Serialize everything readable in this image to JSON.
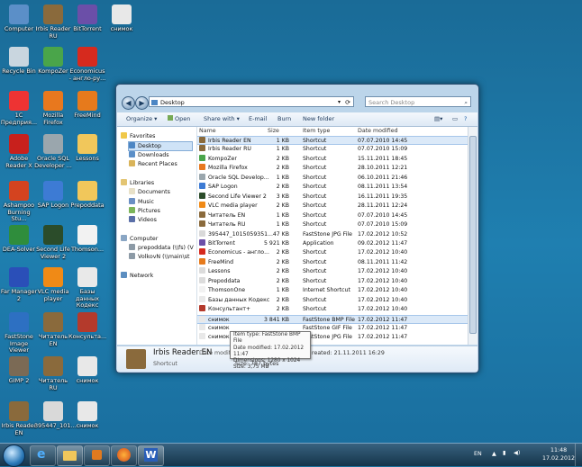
{
  "desktop_icons": [
    {
      "label": "Computer",
      "icon": "computer-icon",
      "color": "#5b8fc8"
    },
    {
      "label": "Irbis Reader RU",
      "icon": "irbis-icon",
      "color": "#8a6a3c"
    },
    {
      "label": "BitTorrent",
      "icon": "bittorrent-icon",
      "color": "#6b4fa8"
    },
    {
      "label": "снимок",
      "icon": "image-file-icon",
      "color": "#e8e8e8"
    },
    {
      "label": "Recycle Bin",
      "icon": "recycle-bin-icon",
      "color": "#c9d6df"
    },
    {
      "label": "KompoZer",
      "icon": "kompozer-icon",
      "color": "#4aa54a"
    },
    {
      "label": "Economicus - англо-ру...",
      "icon": "economicus-icon",
      "color": "#d62a1e"
    },
    {
      "label": "1С Предприя...",
      "icon": "1c-icon",
      "color": "#e33"
    },
    {
      "label": "Mozilla Firefox",
      "icon": "firefox-icon",
      "color": "#e8781e"
    },
    {
      "label": "FreeMind",
      "icon": "freemind-icon",
      "color": "#e67a1c"
    },
    {
      "label": "Adobe Reader X",
      "icon": "adobe-reader-icon",
      "color": "#c8201c"
    },
    {
      "label": "Oracle SQL Developer ...",
      "icon": "oracle-sql-icon",
      "color": "#9aa6ad"
    },
    {
      "label": "Lessons",
      "icon": "folder-icon",
      "color": "#f1c75b"
    },
    {
      "label": "Ashampoo Burning Stu...",
      "icon": "ashampoo-icon",
      "color": "#d4431f"
    },
    {
      "label": "SAP Logon",
      "icon": "sap-icon",
      "color": "#3d7bd4"
    },
    {
      "label": "Prepoddata",
      "icon": "folder-icon",
      "color": "#f1c75b"
    },
    {
      "label": "DEA-Solver",
      "icon": "dea-solver-icon",
      "color": "#2f8d3c"
    },
    {
      "label": "Second Life Viewer 2",
      "icon": "second-life-icon",
      "color": "#2b4c2a"
    },
    {
      "label": "Thomson...",
      "icon": "document-icon",
      "color": "#f2f2f2"
    },
    {
      "label": "Far Manager 2",
      "icon": "far-manager-icon",
      "color": "#2a4fb8"
    },
    {
      "label": "VLC media player",
      "icon": "vlc-icon",
      "color": "#f08a16"
    },
    {
      "label": "Базы данных Кодекс",
      "icon": "kodeks-icon",
      "color": "#e9e9e9"
    },
    {
      "label": "FastStone Image Viewer",
      "icon": "faststone-icon",
      "color": "#2d70c2"
    },
    {
      "label": "Читатель EN",
      "icon": "irbis-icon",
      "color": "#8a6a3c"
    },
    {
      "label": "Консульта...",
      "icon": "consultant-icon",
      "color": "#b43a2c"
    },
    {
      "label": "GIMP 2",
      "icon": "gimp-icon",
      "color": "#7b6a55"
    },
    {
      "label": "Читатель RU",
      "icon": "irbis-icon",
      "color": "#8a6a3c"
    },
    {
      "label": "снимок",
      "icon": "image-file-icon",
      "color": "#e8e8e8"
    },
    {
      "label": "Irbis Reader EN",
      "icon": "irbis-icon",
      "color": "#8a6a3c"
    },
    {
      "label": "395447_101...",
      "icon": "image-file-icon",
      "color": "#d9d9d9"
    },
    {
      "label": "снимок",
      "icon": "image-file-icon",
      "color": "#e8e8e8"
    }
  ],
  "window": {
    "address": "Desktop",
    "search_placeholder": "Search Desktop",
    "toolbar": {
      "organize": "Organize ▾",
      "open": "Open",
      "share": "Share with ▾",
      "email": "E-mail",
      "burn": "Burn",
      "new_folder": "New folder"
    },
    "nav": {
      "favorites": "Favorites",
      "desktop": "Desktop",
      "downloads": "Downloads",
      "recent": "Recent Places",
      "libraries": "Libraries",
      "documents": "Documents",
      "music": "Music",
      "pictures": "Pictures",
      "videos": "Videos",
      "computer": "Computer",
      "drive1": "prepoddata (\\\\fs) (V",
      "drive2": "VolkovN (\\\\main\\st",
      "network": "Network"
    },
    "columns": {
      "name": "Name",
      "size": "Size",
      "type": "Item type",
      "date": "Date modified"
    },
    "files": [
      {
        "name": "Irbis Reader EN",
        "size": "1 KB",
        "type": "Shortcut",
        "date": "07.07.2010 14:45",
        "icon": "irbis-icon",
        "color": "#8a6a3c"
      },
      {
        "name": "Irbis Reader RU",
        "size": "1 KB",
        "type": "Shortcut",
        "date": "07.07.2010 15:09",
        "icon": "irbis-icon",
        "color": "#8a6a3c"
      },
      {
        "name": "KompoZer",
        "size": "2 KB",
        "type": "Shortcut",
        "date": "15.11.2011 18:45",
        "icon": "kompozer-icon",
        "color": "#4aa54a"
      },
      {
        "name": "Mozilla Firefox",
        "size": "2 KB",
        "type": "Shortcut",
        "date": "28.10.2011 12:21",
        "icon": "firefox-icon",
        "color": "#e8781e"
      },
      {
        "name": "Oracle SQL Develop...",
        "size": "1 KB",
        "type": "Shortcut",
        "date": "06.10.2011 21:46",
        "icon": "oracle-sql-icon",
        "color": "#9aa6ad"
      },
      {
        "name": "SAP Logon",
        "size": "2 KB",
        "type": "Shortcut",
        "date": "08.11.2011 13:54",
        "icon": "sap-icon",
        "color": "#3d7bd4"
      },
      {
        "name": "Second Life Viewer 2",
        "size": "3 KB",
        "type": "Shortcut",
        "date": "16.11.2011 19:35",
        "icon": "second-life-icon",
        "color": "#2b4c2a"
      },
      {
        "name": "VLC media player",
        "size": "2 KB",
        "type": "Shortcut",
        "date": "28.11.2011 12:24",
        "icon": "vlc-icon",
        "color": "#f08a16"
      },
      {
        "name": "Читатель EN",
        "size": "1 KB",
        "type": "Shortcut",
        "date": "07.07.2010 14:45",
        "icon": "irbis-icon",
        "color": "#8a6a3c"
      },
      {
        "name": "Читатель RU",
        "size": "1 KB",
        "type": "Shortcut",
        "date": "07.07.2010 15:09",
        "icon": "irbis-icon",
        "color": "#8a6a3c"
      },
      {
        "name": "395447_1015059351...",
        "size": "47 KB",
        "type": "FastStone JPG File",
        "date": "17.02.2012 10:52",
        "icon": "image-file-icon",
        "color": "#d9d9d9"
      },
      {
        "name": "BitTorrent",
        "size": "5 921 KB",
        "type": "Application",
        "date": "09.02.2012 11:47",
        "icon": "bittorrent-icon",
        "color": "#6b4fa8"
      },
      {
        "name": "Economicus - англо...",
        "size": "2 KB",
        "type": "Shortcut",
        "date": "17.02.2012 10:40",
        "icon": "economicus-icon",
        "color": "#d62a1e"
      },
      {
        "name": "FreeMind",
        "size": "2 KB",
        "type": "Shortcut",
        "date": "08.11.2011 11:42",
        "icon": "freemind-icon",
        "color": "#e67a1c"
      },
      {
        "name": "Lessons",
        "size": "2 KB",
        "type": "Shortcut",
        "date": "17.02.2012 10:40",
        "icon": "shortcut-icon",
        "color": "#dcdcdc"
      },
      {
        "name": "Prepoddata",
        "size": "2 KB",
        "type": "Shortcut",
        "date": "17.02.2012 10:40",
        "icon": "shortcut-icon",
        "color": "#dcdcdc"
      },
      {
        "name": "ThomsonOne",
        "size": "1 KB",
        "type": "Internet Shortcut",
        "date": "17.02.2012 10:40",
        "icon": "document-icon",
        "color": "#f2f2f2"
      },
      {
        "name": "Базы данных Кодекс",
        "size": "2 KB",
        "type": "Shortcut",
        "date": "17.02.2012 10:40",
        "icon": "kodeks-icon",
        "color": "#e9e9e9"
      },
      {
        "name": "Консультант+",
        "size": "2 KB",
        "type": "Shortcut",
        "date": "17.02.2012 10:40",
        "icon": "consultant-icon",
        "color": "#b43a2c"
      },
      {
        "name": "снимок",
        "size": "3 841 KB",
        "type": "FastStone BMP File",
        "date": "17.02.2012 11:47",
        "icon": "image-file-icon",
        "color": "#e8e8e8"
      },
      {
        "name": "снимок",
        "size": "",
        "type": "FastStone GIF File",
        "date": "17.02.2012 11:47",
        "icon": "image-file-icon",
        "color": "#e8e8e8"
      },
      {
        "name": "снимок",
        "size": "",
        "type": "FastStone JPG File",
        "date": "17.02.2012 11:47",
        "icon": "image-file-icon",
        "color": "#e8e8e8"
      }
    ],
    "details": {
      "name": "Irbis Reader EN",
      "type": "Shortcut",
      "date_modified": "Date modified:",
      "created": "reated: 21.11.2011 16:29",
      "size": "Size: 787 bytes"
    },
    "tooltip": {
      "line1": "Item type: FastStone BMP File",
      "line2": "Date modified: 17.02.2012 11:47",
      "line3": "Dimensions: 1280 x 1024",
      "line4": "Size: 3,75 MB"
    }
  },
  "taskbar": {
    "lang": "EN",
    "time": "11:48",
    "date": "17.02.2012"
  }
}
